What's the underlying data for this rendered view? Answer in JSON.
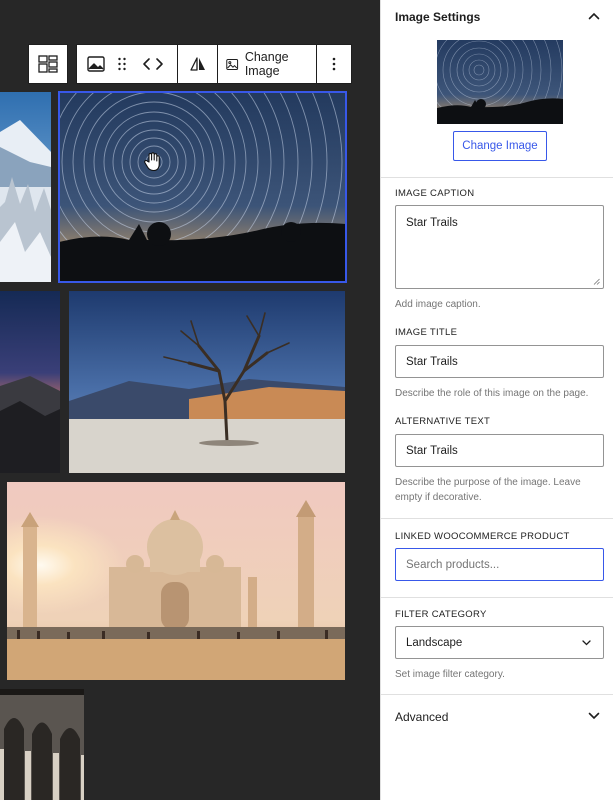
{
  "toolbar": {
    "change_image_label": "Change Image",
    "icons": [
      "grid-layout-icon",
      "image-icon",
      "drag-handle-icon",
      "code-arrows-icon",
      "flip-icon",
      "image-icon",
      "more-vertical-icon"
    ]
  },
  "sidebar": {
    "panel_title": "Image Settings",
    "change_image_button": "Change Image",
    "caption": {
      "label": "IMAGE CAPTION",
      "value": "Star Trails",
      "help": "Add image caption."
    },
    "title": {
      "label": "IMAGE TITLE",
      "value": "Star Trails",
      "help": "Describe the role of this image on the page."
    },
    "alt": {
      "label": "ALTERNATIVE TEXT",
      "value": "Star Trails",
      "help": "Describe the purpose of the image. Leave empty if decorative."
    },
    "product": {
      "label": "LINKED WOOCOMMERCE PRODUCT",
      "placeholder": "Search products..."
    },
    "filter": {
      "label": "FILTER CATEGORY",
      "selected": "Landscape",
      "help": "Set image filter category."
    },
    "advanced_label": "Advanced"
  },
  "colors": {
    "accent": "#3858e9",
    "canvas_bg": "#272727",
    "text": "#1e1e1e",
    "muted": "#757575"
  }
}
